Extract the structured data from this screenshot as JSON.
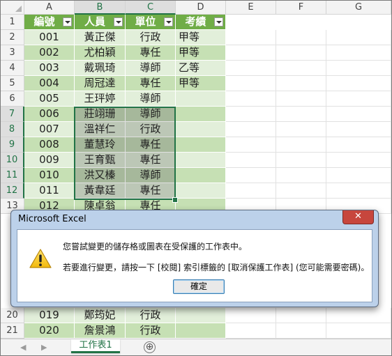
{
  "columns": [
    "A",
    "B",
    "C",
    "D",
    "E",
    "F",
    "G"
  ],
  "headers": [
    "編號",
    "人員",
    "單位",
    "考績"
  ],
  "rows": [
    {
      "num": "2",
      "a": "001",
      "b": "黃正傑",
      "c": "行政",
      "d": "甲等"
    },
    {
      "num": "3",
      "a": "002",
      "b": "尤柏穎",
      "c": "專任",
      "d": "甲等"
    },
    {
      "num": "4",
      "a": "003",
      "b": "戴珮琦",
      "c": "導師",
      "d": "乙等"
    },
    {
      "num": "5",
      "a": "004",
      "b": "周冠達",
      "c": "專任",
      "d": "甲等"
    },
    {
      "num": "6",
      "a": "005",
      "b": "王玶婷",
      "c": "導師",
      "d": ""
    },
    {
      "num": "7",
      "a": "006",
      "b": "莊翊珊",
      "c": "導師",
      "d": ""
    },
    {
      "num": "8",
      "a": "007",
      "b": "溫祥仁",
      "c": "行政",
      "d": ""
    },
    {
      "num": "9",
      "a": "008",
      "b": "董慧玲",
      "c": "專任",
      "d": ""
    },
    {
      "num": "10",
      "a": "009",
      "b": "王育甄",
      "c": "專任",
      "d": ""
    },
    {
      "num": "11",
      "a": "010",
      "b": "洪又榛",
      "c": "導師",
      "d": ""
    },
    {
      "num": "12",
      "a": "011",
      "b": "黃韋廷",
      "c": "專任",
      "d": ""
    },
    {
      "num": "13",
      "a": "012",
      "b": "陳卓翁",
      "c": "專任",
      "d": ""
    }
  ],
  "bottom_rows": [
    {
      "num": "20",
      "a": "019",
      "b": "鄭筠妃",
      "c": "行政",
      "d": ""
    },
    {
      "num": "21",
      "a": "020",
      "b": "詹景鴻",
      "c": "行政",
      "d": ""
    }
  ],
  "header_row_num": "1",
  "sheet_tab": "工作表1",
  "add_sheet": "⊕",
  "nav_prev": "◀",
  "nav_next": "▶",
  "dialog": {
    "title": "Microsoft Excel",
    "close": "✕",
    "icon": "warning-icon",
    "message1": "您嘗試變更的儲存格或圖表在受保護的工作表中。",
    "message2": "若要進行變更，請按一下 [校閱] 索引標籤的 [取消保護工作表] (您可能需要密碼)。",
    "ok": "確定"
  },
  "colors": {
    "accent": "#217346",
    "table_header": "#70ad47",
    "band_light": "#e2efda",
    "band_dark": "#c6e0b4"
  }
}
